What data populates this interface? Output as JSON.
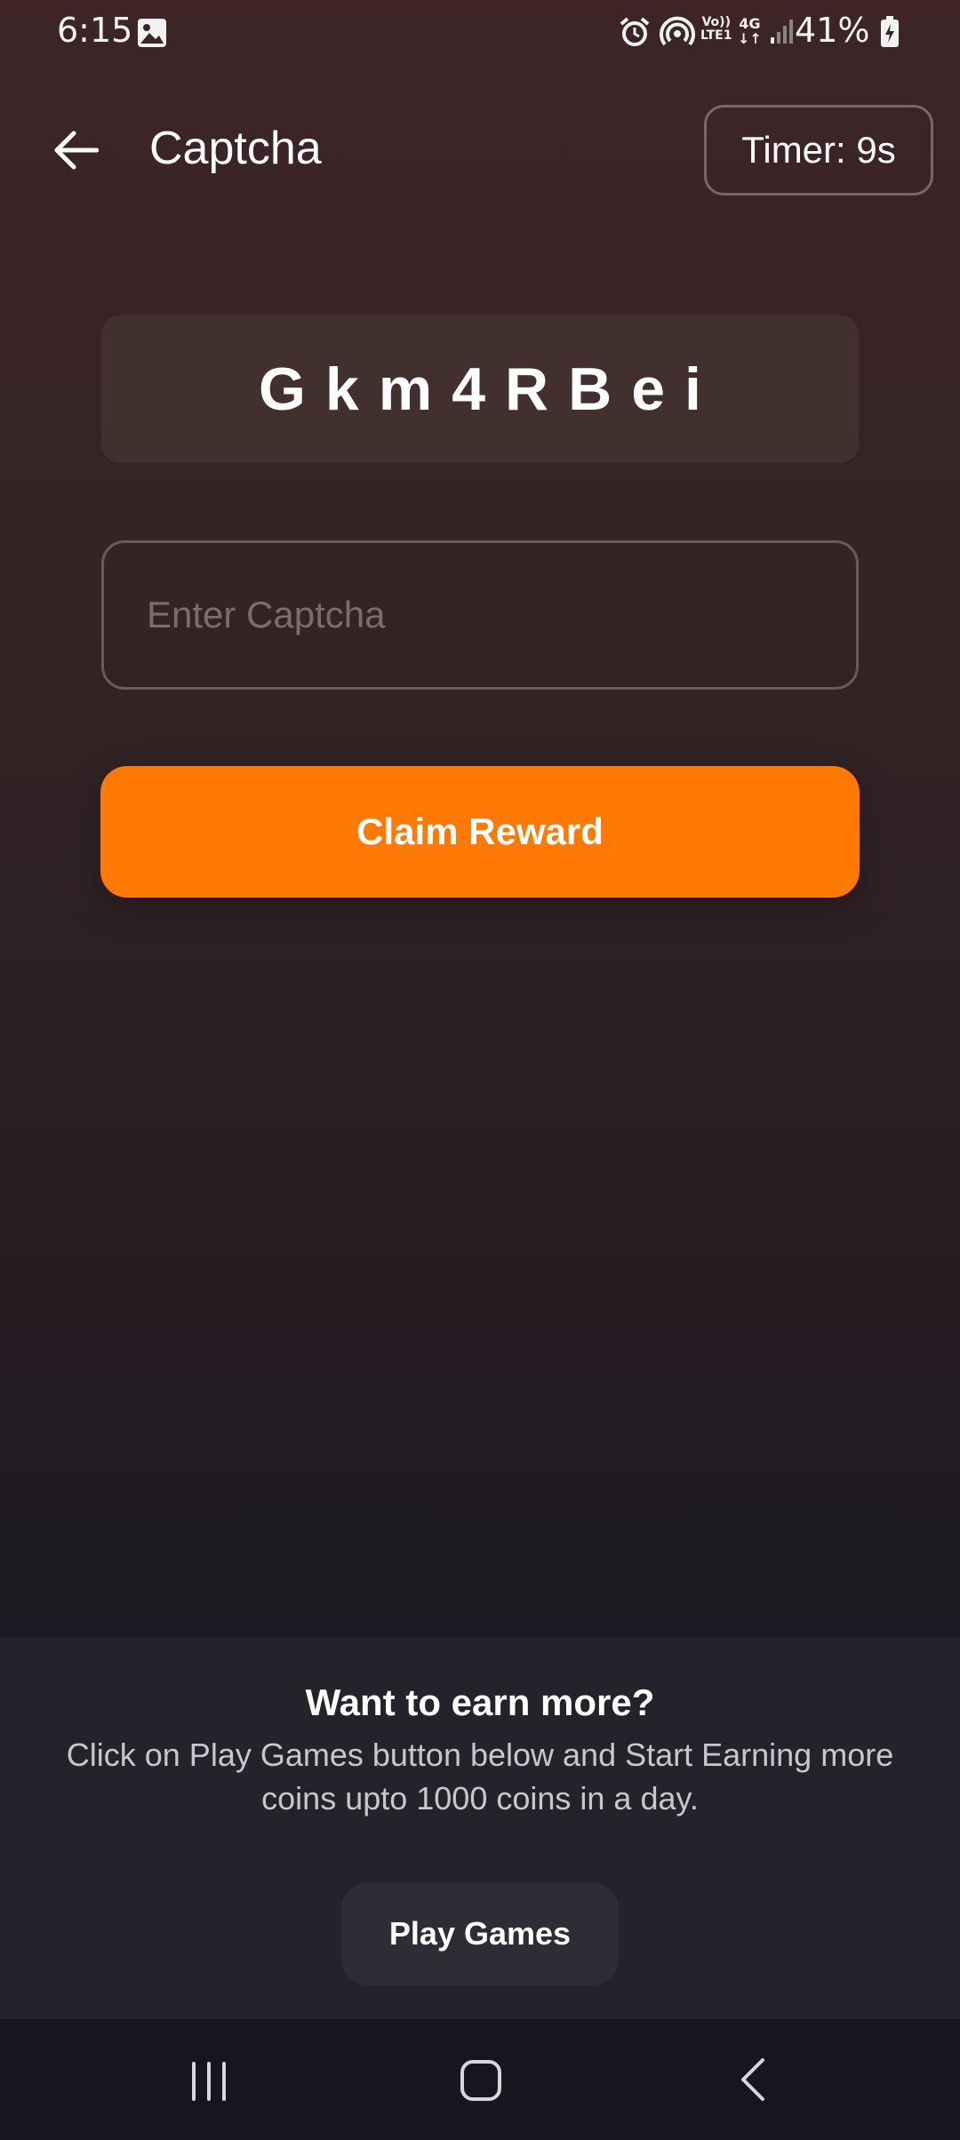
{
  "status_bar": {
    "time": "6:15",
    "volte_line1": "Vo))",
    "volte_line2": "LTE1",
    "network_type": "4G",
    "battery_percent": "41%"
  },
  "app_bar": {
    "title": "Captcha",
    "timer": "Timer: 9s"
  },
  "captcha": {
    "code": "Gkm4RBei"
  },
  "input": {
    "placeholder": "Enter Captcha",
    "value": ""
  },
  "claim_button": {
    "label": "Claim Reward",
    "color": "#ff7a05"
  },
  "promo": {
    "title": "Want to earn more?",
    "text": "Click on Play Games button below and Start Earning more coins upto 1000 coins in a day.",
    "button_label": "Play Games"
  },
  "icons": {
    "back": "back-arrow-icon",
    "status": [
      "gallery-icon",
      "alarm-icon",
      "hotspot-icon",
      "signal-icon",
      "battery-charging-icon"
    ],
    "nav": [
      "recent-apps-icon",
      "home-icon",
      "nav-back-icon"
    ]
  }
}
